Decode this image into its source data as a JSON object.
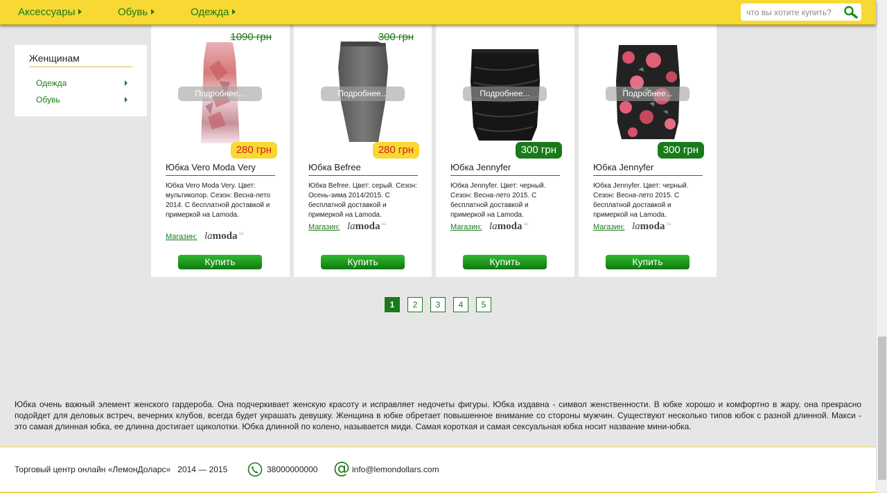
{
  "nav": {
    "items": [
      {
        "label": "Аксессуары"
      },
      {
        "label": "Обувь"
      },
      {
        "label": "Одежда"
      }
    ]
  },
  "search": {
    "placeholder": "что вы хотите купить?",
    "icon": "search-icon"
  },
  "sidebar": {
    "title": "Женщинам",
    "items": [
      {
        "label": "Одежда"
      },
      {
        "label": "Обувь"
      }
    ]
  },
  "products": [
    {
      "old_price": "1090 грн",
      "price": "280 грн",
      "price_style": "sale",
      "details_label": "Подробнее...",
      "title": "Юбка Vero Moda Very",
      "description": "Юбка Vero Moda Very. Цвет: мультиколор. Сезон: Весна-лето 2014. С бесплатной доставкой и примеркой на Lamoda.",
      "store_label": "Магазин:",
      "store_logo": "lamoda",
      "buy_label": "Купить"
    },
    {
      "old_price": "300 грн",
      "price": "280 грн",
      "price_style": "sale",
      "details_label": "Подробнее...",
      "title": "Юбка Befree",
      "description": "Юбка Befree. Цвет: серый. Сезон: Осень-зима 2014/2015. С бесплатной доставкой и примеркой на Lamoda.",
      "store_label": "Магазин:",
      "store_logo": "lamoda",
      "buy_label": "Купить"
    },
    {
      "old_price": "",
      "price": "300 грн",
      "price_style": "reg",
      "details_label": "Подробнее...",
      "title": "Юбка Jennyfer",
      "description": "Юбка Jennyfer. Цвет: черный. Сезон: Весна-лето 2015. С бесплатной доставкой и примеркой на Lamoda.",
      "store_label": "Магазин:",
      "store_logo": "lamoda",
      "buy_label": "Купить"
    },
    {
      "old_price": "",
      "price": "300 грн",
      "price_style": "reg",
      "details_label": "Подробнее...",
      "title": "Юбка Jennyfer",
      "description": "Юбка Jennyfer. Цвет: черный. Сезон: Весна-лето 2015. С бесплатной доставкой и примеркой на Lamoda.",
      "store_label": "Магазин:",
      "store_logo": "lamoda",
      "buy_label": "Купить"
    }
  ],
  "pagination": {
    "pages": [
      "1",
      "2",
      "3",
      "4",
      "5"
    ],
    "current": "1"
  },
  "seo_text": "Юбка очень важный элемент женского гардероба. Она подчеркивает женскую красоту и исправляет недочеты фигуры. Юбка издавна - символ женственности. В юбке хорошо и комфортно в жару, она прекрасно подойдет для деловых встреч, вечерних клубов, всегда будет украшать девушку. Женщина в юбке обретает повышенное внимание со стороны мужчин. Существуют несколько типов юбок с разной длинной. Макси - это самая длинная юбка, ее длинна достигает щиколотки. Юбка длинной по колено, называется миди. Самая короткая и самая сексуальная юбка носит название мини-юбка.",
  "footer": {
    "copyright": "Торговый центр онлайн «ЛемонДоларс»   2014 — 2015",
    "phone": "38000000000",
    "email": "info@lemondollars.com"
  },
  "colors": {
    "nav_bg": "#f8d832",
    "accent_green": "#1a7a1a",
    "sale_red": "#d21d1d",
    "page_bg": "#e6e6e6"
  },
  "scrollbar": {
    "position_fraction": 0.69,
    "visible_fraction": 0.29
  }
}
